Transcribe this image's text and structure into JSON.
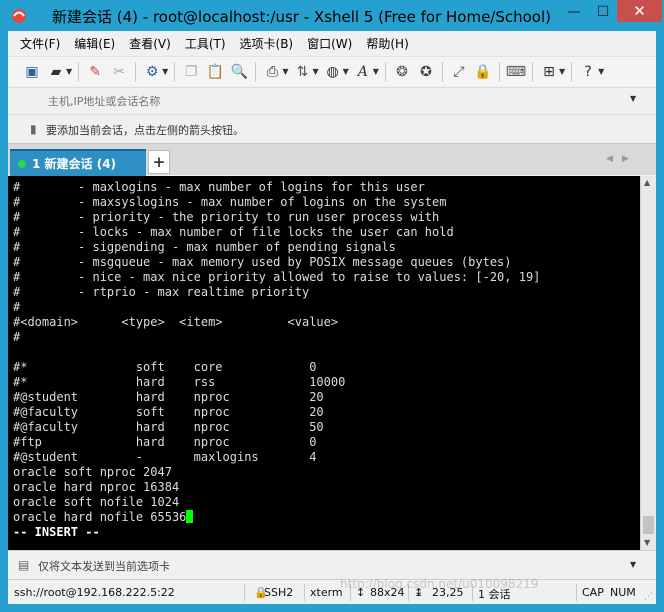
{
  "window": {
    "title": "新建会话 (4) - root@localhost:/usr - Xshell 5 (Free for Home/School)",
    "controls": {
      "minimize": "—",
      "maximize": "☐",
      "close": "✕"
    }
  },
  "menu": {
    "items": [
      "文件(F)",
      "编辑(E)",
      "查看(V)",
      "工具(T)",
      "选项卡(B)",
      "窗口(W)",
      "帮助(H)"
    ]
  },
  "toolbar": {
    "icons": [
      "new-session-icon",
      "open-folder-icon",
      "connect-icon",
      "disconnect-icon",
      "session-properties-icon",
      "copy-icon",
      "paste-icon",
      "find-icon",
      "print-icon",
      "transfer-icon",
      "globe-icon",
      "font-icon",
      "xftp-icon",
      "xmanager-icon",
      "fullscreen-icon",
      "lock-icon",
      "keyboard-icon",
      "add-icon",
      "help-icon"
    ]
  },
  "address": {
    "placeholder": "主机,IP地址或会话名称"
  },
  "hint": {
    "text": "要添加当前会话，点击左侧的箭头按钮。"
  },
  "tabs": {
    "active_label": "1 新建会话 (4)",
    "add_label": "+"
  },
  "terminal": {
    "lines": [
      "#        - maxlogins - max number of logins for this user",
      "#        - maxsyslogins - max number of logins on the system",
      "#        - priority - the priority to run user process with",
      "#        - locks - max number of file locks the user can hold",
      "#        - sigpending - max number of pending signals",
      "#        - msgqueue - max memory used by POSIX message queues (bytes)",
      "#        - nice - max nice priority allowed to raise to values: [-20, 19]",
      "#        - rtprio - max realtime priority",
      "#",
      "#<domain>      <type>  <item>         <value>",
      "#",
      "",
      "#*               soft    core            0",
      "#*               hard    rss             10000",
      "#@student        hard    nproc           20",
      "#@faculty        soft    nproc           20",
      "#@faculty        hard    nproc           50",
      "#ftp             hard    nproc           0",
      "#@student        -       maxlogins       4",
      "oracle soft nproc 2047",
      "oracle hard nproc 16384",
      "oracle soft nofile 1024"
    ],
    "cursor_line": "oracle hard nofile 65536",
    "mode_line": "-- INSERT --"
  },
  "sendbar": {
    "text": "仅将文本发送到当前选项卡"
  },
  "status": {
    "host": "ssh://root@192.168.222.5:22",
    "protocol": "SSH2",
    "term": "xterm",
    "size_icon": "↕",
    "size": "88x24",
    "pos_icon": "↨",
    "pos": "23,25",
    "sessions": "1 会话",
    "cap": "CAP",
    "num": "NUM"
  },
  "watermark": "http://blog.csdn.net/u010098219"
}
